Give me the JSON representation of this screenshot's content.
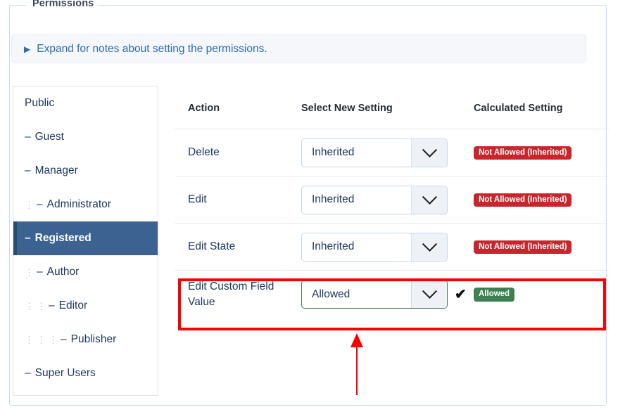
{
  "panel": {
    "legend": "Permissions"
  },
  "notes": {
    "caret_icon": "triangle-right-icon",
    "text": "Expand for notes about setting the permissions."
  },
  "sidebar": {
    "items": [
      {
        "label": "Public",
        "depth": 0,
        "prefix": "",
        "active": false
      },
      {
        "label": "Guest",
        "depth": 0,
        "prefix": "–",
        "active": false
      },
      {
        "label": "Manager",
        "depth": 0,
        "prefix": "–",
        "active": false
      },
      {
        "label": "Administrator",
        "depth": 1,
        "prefix": "–",
        "active": false
      },
      {
        "label": "Registered",
        "depth": 0,
        "prefix": "–",
        "active": true
      },
      {
        "label": "Author",
        "depth": 1,
        "prefix": "–",
        "active": false
      },
      {
        "label": "Editor",
        "depth": 2,
        "prefix": "–",
        "active": false
      },
      {
        "label": "Publisher",
        "depth": 3,
        "prefix": "–",
        "active": false
      },
      {
        "label": "Super Users",
        "depth": 0,
        "prefix": "–",
        "active": false
      }
    ],
    "active_color": "#3c6291"
  },
  "table": {
    "headers": {
      "action": "Action",
      "select": "Select New Setting",
      "calculated": "Calculated Setting"
    },
    "rows": [
      {
        "action": "Delete",
        "setting": "Inherited",
        "calculated": "Not Allowed (Inherited)",
        "calculated_state": "red",
        "changed": false,
        "checked": false
      },
      {
        "action": "Edit",
        "setting": "Inherited",
        "calculated": "Not Allowed (Inherited)",
        "calculated_state": "red",
        "changed": false,
        "checked": false
      },
      {
        "action": "Edit State",
        "setting": "Inherited",
        "calculated": "Not Allowed (Inherited)",
        "calculated_state": "red",
        "changed": false,
        "checked": false
      },
      {
        "action": "Edit Custom Field Value",
        "setting": "Allowed",
        "calculated": "Allowed",
        "calculated_state": "green",
        "changed": true,
        "checked": true,
        "check_icon": "checkmark-icon"
      }
    ]
  },
  "annotations": {
    "highlight_color": "#fb0000",
    "arrow_icon": "up-arrow-icon"
  },
  "colors": {
    "badge_red": "#c9252d",
    "badge_green": "#3e8050",
    "accent_blue": "#2b6cb0"
  }
}
